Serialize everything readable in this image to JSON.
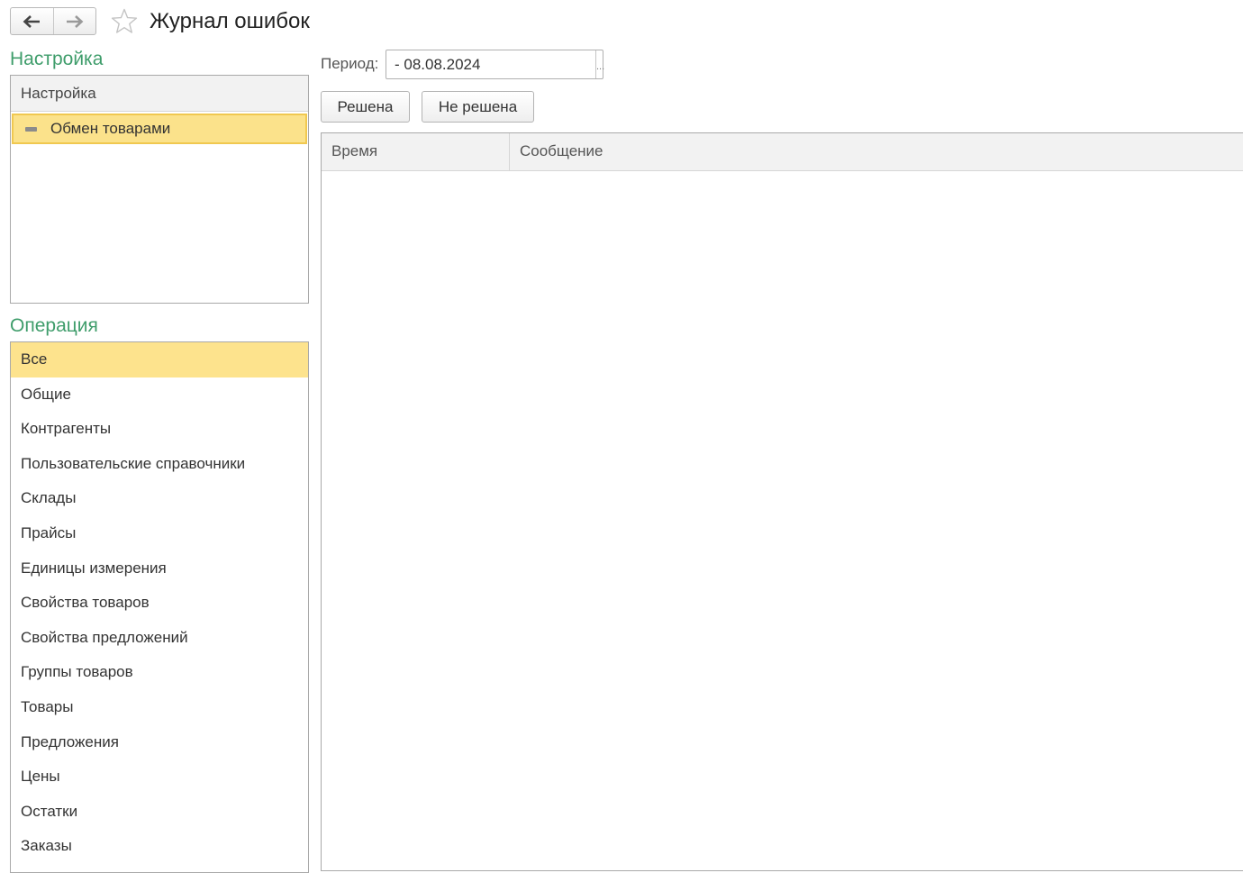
{
  "window": {
    "title": "Журнал ошибок"
  },
  "nav": {
    "back_icon": "arrow-left-icon",
    "forward_icon": "arrow-right-icon",
    "favorite_icon": "star-outline-icon"
  },
  "settings": {
    "section_title": "Настройка",
    "column_header": "Настройка",
    "items": [
      {
        "label": "Обмен товарами",
        "icon": "minus-icon",
        "selected": true
      }
    ]
  },
  "operation": {
    "section_title": "Операция",
    "items": [
      {
        "label": "Все",
        "selected": true
      },
      {
        "label": "Общие"
      },
      {
        "label": "Контрагенты"
      },
      {
        "label": "Пользовательские справочники"
      },
      {
        "label": "Склады"
      },
      {
        "label": "Прайсы"
      },
      {
        "label": "Единицы измерения"
      },
      {
        "label": "Свойства товаров"
      },
      {
        "label": "Свойства предложений"
      },
      {
        "label": "Группы товаров"
      },
      {
        "label": "Товары"
      },
      {
        "label": "Предложения"
      },
      {
        "label": "Цены"
      },
      {
        "label": "Остатки"
      },
      {
        "label": "Заказы"
      }
    ]
  },
  "period": {
    "label": "Период:",
    "value": "- 08.08.2024",
    "select_button": "..."
  },
  "buttons": {
    "resolved": "Решена",
    "not_resolved": "Не решена"
  },
  "grid": {
    "columns": [
      "Время",
      "Сообщение"
    ],
    "rows": []
  },
  "colors": {
    "section_title": "#3f9d6b",
    "selection": "#fde38d"
  }
}
